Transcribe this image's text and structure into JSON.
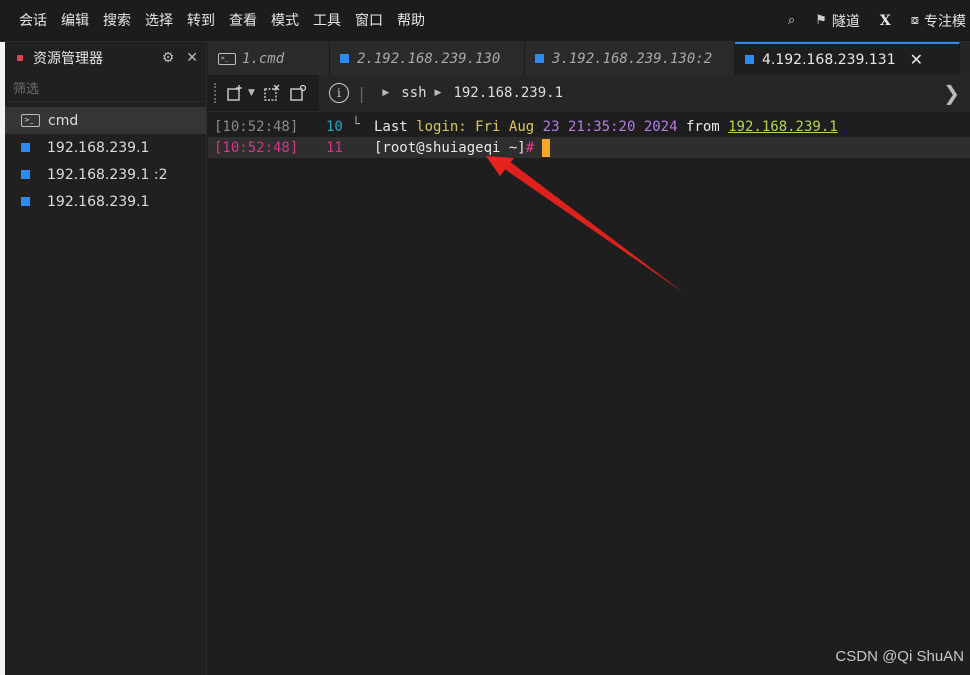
{
  "menubar": {
    "items": [
      "会话",
      "编辑",
      "搜索",
      "选择",
      "转到",
      "查看",
      "模式",
      "工具",
      "窗口",
      "帮助"
    ],
    "tunnel_label": "隧道",
    "x_label": "X",
    "focus_label": "专注模"
  },
  "sidebar": {
    "title": "资源管理器",
    "filter_placeholder": "筛选",
    "items": [
      {
        "label": "cmd",
        "icon": "terminal-icon"
      },
      {
        "label": "192.168.239.1",
        "icon": "square-icon"
      },
      {
        "label": "192.168.239.1  :2",
        "icon": "square-icon"
      },
      {
        "label": "192.168.239.1",
        "icon": "square-icon"
      }
    ]
  },
  "tabs": [
    {
      "label": "1.cmd"
    },
    {
      "label": "2.192.168.239.130"
    },
    {
      "label": "3.192.168.239.130:2"
    },
    {
      "label": "4.192.168.239.131"
    }
  ],
  "toolbar": {
    "crumb_ssh": "ssh",
    "crumb_host": "192.168.239.1"
  },
  "terminal": {
    "line1": {
      "timestamp": "[10:52:48]",
      "number": "10",
      "last": "Last",
      "login": "login:",
      "day": "Fri",
      "month": "Aug",
      "date": "23",
      "time": "21:35:20",
      "year": "2024",
      "from": "from",
      "ip": "192.168.239.1"
    },
    "line2": {
      "timestamp": "[10:52:48]",
      "number": "11",
      "prompt": "[root@shuiageqi ~]",
      "hash": "#"
    }
  },
  "watermark": "CSDN @Qi ShuAN",
  "colors": {
    "accent": "#2b8bf2",
    "cursor": "#f5a623",
    "arrow": "#e8231f"
  }
}
